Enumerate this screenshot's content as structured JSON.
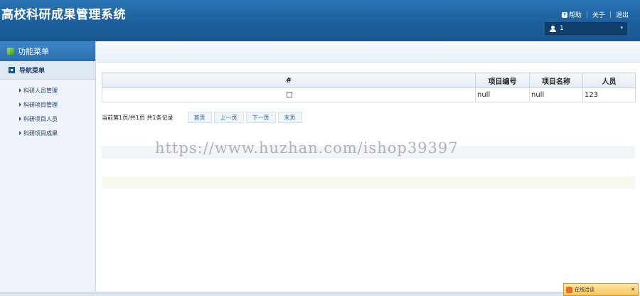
{
  "header": {
    "title": "高校科研成果管理系统",
    "help": "帮助",
    "about": "关于",
    "logout": "退出",
    "user": "1"
  },
  "sidebar": {
    "title": "功能菜单",
    "nav_title": "导航菜单",
    "items": [
      {
        "label": "科研人员管理"
      },
      {
        "label": "科研项目管理"
      },
      {
        "label": "科研项目人员"
      },
      {
        "label": "科研项目成果"
      }
    ]
  },
  "grid": {
    "headers": [
      "#",
      "项目编号",
      "项目名称",
      "人员"
    ],
    "rows": [
      {
        "id": "null",
        "name": "null",
        "person": "123"
      }
    ]
  },
  "pager": {
    "info": "当前第1页/共1页  共1条记录",
    "first": "首页",
    "prev": "上一页",
    "next": "下一页",
    "last": "末页"
  },
  "watermark": "https://www.huzhan.com/ishop39397",
  "chat": {
    "label": "在线洽谈"
  }
}
